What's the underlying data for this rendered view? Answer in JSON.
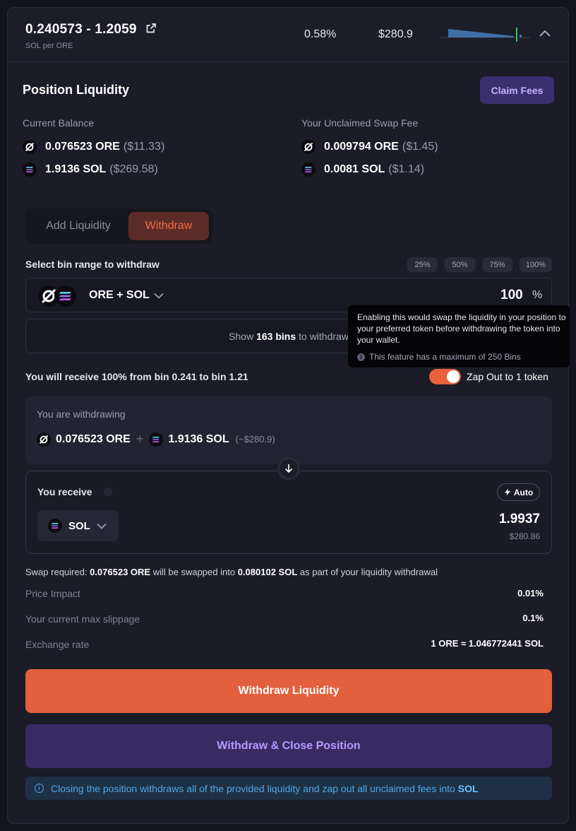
{
  "header": {
    "range": "0.240573 - 1.2059",
    "unit": "SOL per ORE",
    "apr": "0.58%",
    "value": "$280.9"
  },
  "position": {
    "title": "Position Liquidity",
    "claim_fees_label": "Claim Fees",
    "current_balance_label": "Current Balance",
    "unclaimed_label": "Your Unclaimed Swap Fee",
    "balances": [
      {
        "amount": "0.076523 ORE",
        "usd": "($11.33)",
        "icon": "ore-icon"
      },
      {
        "amount": "1.9136 SOL",
        "usd": "($269.58)",
        "icon": "sol-icon"
      }
    ],
    "unclaimed": [
      {
        "amount": "0.009794 ORE",
        "usd": "($1.45)",
        "icon": "ore-icon"
      },
      {
        "amount": "0.0081 SOL",
        "usd": "($1.14)",
        "icon": "sol-icon"
      }
    ]
  },
  "tabs": {
    "add": "Add Liquidity",
    "withdraw": "Withdraw",
    "active": "withdraw"
  },
  "bin_range": {
    "label": "Select bin range to withdraw",
    "chips": [
      "25%",
      "50%",
      "75%",
      "100%"
    ],
    "pair": "ORE + SOL",
    "amount": "100",
    "percent_sign": "%",
    "show_bins_prefix": "Show",
    "show_bins_count": "163 bins",
    "show_bins_suffix": "to withdraw"
  },
  "tooltip": {
    "text": "Enabling this would swap the liquidity in your position to your preferred token before withdrawing the token into your wallet.",
    "note": "This feature has a maximum of 250 Bins"
  },
  "receive_line": "You will receive 100% from bin 0.241 to bin 1.21",
  "zap": {
    "label": "Zap Out to 1 token",
    "enabled": true
  },
  "withdrawing": {
    "title": "You are withdrawing",
    "ore": "0.076523 ORE",
    "plus": "+",
    "sol": "1.9136 SOL",
    "approx": "(~$280.9)"
  },
  "receive": {
    "title": "You receive",
    "auto_label": "Auto",
    "token": "SOL",
    "amount": "1.9937",
    "usd": "$280.86"
  },
  "swap_note": {
    "prefix": "Swap required:",
    "from": "0.076523 ORE",
    "middle": "will be swapped into",
    "to": "0.080102 SOL",
    "suffix": "as part of your liquidity withdrawal"
  },
  "stats": [
    {
      "label": "Price Impact",
      "value": "0.01%"
    },
    {
      "label": "Your current max slippage",
      "value": "0.1%"
    },
    {
      "label": "Exchange rate",
      "value": "1 ORE ≈ 1.046772441 SOL"
    }
  ],
  "actions": {
    "withdraw": "Withdraw Liquidity",
    "withdraw_close": "Withdraw & Close Position"
  },
  "info": {
    "text": "Closing the position withdraws all of the provided liquidity and zap out all unclaimed fees into",
    "token": "SOL"
  },
  "colors": {
    "accent": "#e2603e",
    "purple": "#382b63",
    "info": "#4fa7e8"
  }
}
